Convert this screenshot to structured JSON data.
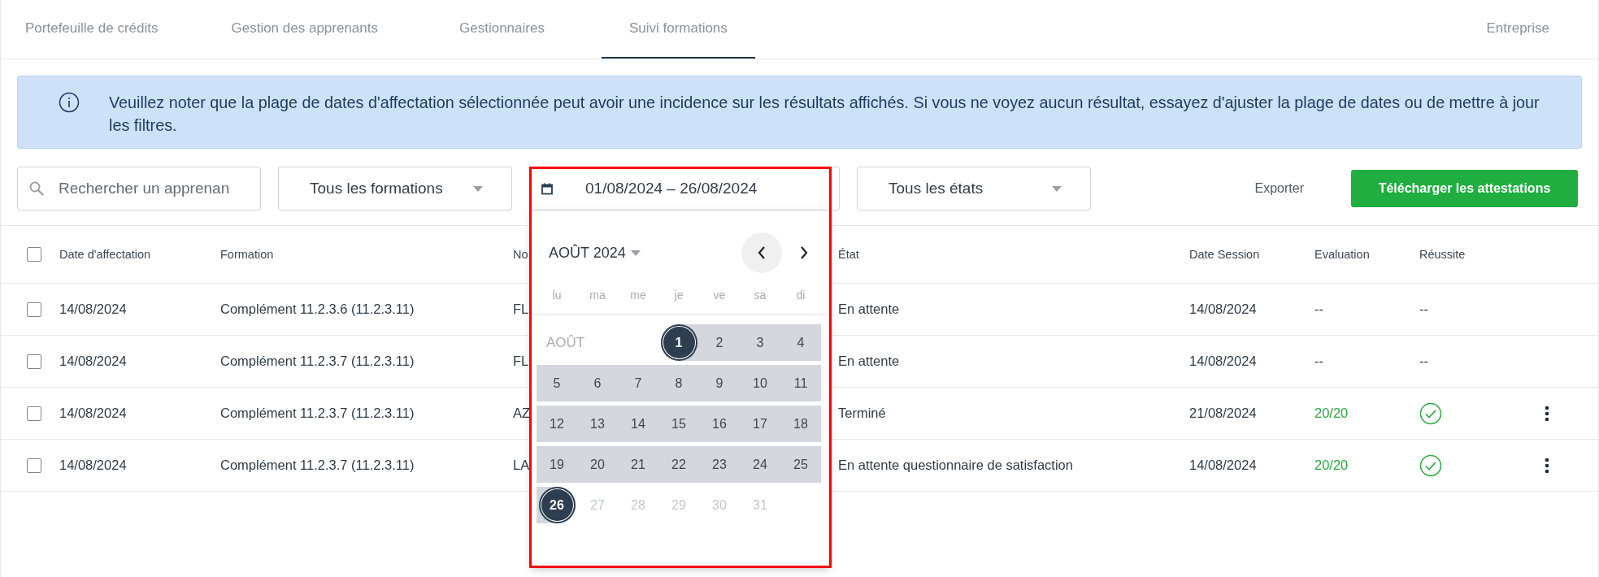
{
  "tabs": [
    {
      "label": "Portefeuille de crédits",
      "selected": false
    },
    {
      "label": "Gestion des apprenants",
      "selected": false
    },
    {
      "label": "Gestionnaires",
      "selected": false
    },
    {
      "label": "Suivi formations",
      "selected": true
    }
  ],
  "company_link": "Entreprise",
  "notice": "Veuillez noter que la plage de dates d'affectation sélectionnée peut avoir une incidence sur les résultats affichés. Si vous ne voyez aucun résultat, essayez d'ajuster la plage de dates ou de mettre à jour les filtres.",
  "search": {
    "placeholder": "Rechercher un apprenan"
  },
  "formation_filter": "Tous les formations",
  "date_filter": {
    "value": "01/08/2024 – 26/08/2024",
    "highlighted": true,
    "open": true
  },
  "state_filter": "Tous les états",
  "export_link": "Exporter",
  "download_button": "Télécharger les attestations",
  "calendar": {
    "title": "AOÛT 2024",
    "month_label": "AOÛT",
    "weekdays": [
      "lu",
      "ma",
      "me",
      "je",
      "ve",
      "sa",
      "di"
    ],
    "weeks": [
      [
        {
          "day": "1",
          "selected": true,
          "in_range": false,
          "disabled": false
        },
        {
          "day": "2",
          "selected": false,
          "in_range": true,
          "disabled": false
        },
        {
          "day": "3",
          "selected": false,
          "in_range": true,
          "disabled": false
        },
        {
          "day": "4",
          "selected": false,
          "in_range": true,
          "disabled": false
        }
      ],
      [
        {
          "day": "5",
          "selected": false,
          "in_range": true,
          "disabled": false
        },
        {
          "day": "6",
          "selected": false,
          "in_range": true,
          "disabled": false
        },
        {
          "day": "7",
          "selected": false,
          "in_range": true,
          "disabled": false
        },
        {
          "day": "8",
          "selected": false,
          "in_range": true,
          "disabled": false
        },
        {
          "day": "9",
          "selected": false,
          "in_range": true,
          "disabled": false
        },
        {
          "day": "10",
          "selected": false,
          "in_range": true,
          "disabled": false
        },
        {
          "day": "11",
          "selected": false,
          "in_range": true,
          "disabled": false
        }
      ],
      [
        {
          "day": "12",
          "selected": false,
          "in_range": true,
          "disabled": false
        },
        {
          "day": "13",
          "selected": false,
          "in_range": true,
          "disabled": false
        },
        {
          "day": "14",
          "selected": false,
          "in_range": true,
          "disabled": false
        },
        {
          "day": "15",
          "selected": false,
          "in_range": true,
          "disabled": false
        },
        {
          "day": "16",
          "selected": false,
          "in_range": true,
          "disabled": false
        },
        {
          "day": "17",
          "selected": false,
          "in_range": true,
          "disabled": false
        },
        {
          "day": "18",
          "selected": false,
          "in_range": true,
          "disabled": false
        }
      ],
      [
        {
          "day": "19",
          "selected": false,
          "in_range": true,
          "disabled": false
        },
        {
          "day": "20",
          "selected": false,
          "in_range": true,
          "disabled": false
        },
        {
          "day": "21",
          "selected": false,
          "in_range": true,
          "disabled": false
        },
        {
          "day": "22",
          "selected": false,
          "in_range": true,
          "disabled": false
        },
        {
          "day": "23",
          "selected": false,
          "in_range": true,
          "disabled": false
        },
        {
          "day": "24",
          "selected": false,
          "in_range": true,
          "disabled": false
        },
        {
          "day": "25",
          "selected": false,
          "in_range": true,
          "disabled": false
        }
      ],
      [
        {
          "day": "26",
          "selected": true,
          "in_range": false,
          "disabled": false
        },
        {
          "day": "27",
          "selected": false,
          "in_range": false,
          "disabled": true
        },
        {
          "day": "28",
          "selected": false,
          "in_range": false,
          "disabled": true
        },
        {
          "day": "29",
          "selected": false,
          "in_range": false,
          "disabled": true
        },
        {
          "day": "30",
          "selected": false,
          "in_range": false,
          "disabled": true
        },
        {
          "day": "31",
          "selected": false,
          "in_range": false,
          "disabled": true
        }
      ]
    ]
  },
  "table": {
    "select_all_checked": false,
    "columns": [
      "Date d'affectation",
      "Formation",
      "No",
      "État",
      "Date Session",
      "Evaluation",
      "Réussite"
    ],
    "rows": [
      {
        "checked": false,
        "date": "14/08/2024",
        "formation": "Complément 11.2.3.6 (11.2.3.11)",
        "name": "FL",
        "state": "En attente",
        "session": "14/08/2024",
        "evaluation": "--",
        "evaluation_passed": false,
        "success": {
          "kind": "text",
          "text": "--"
        },
        "has_menu": false
      },
      {
        "checked": false,
        "date": "14/08/2024",
        "formation": "Complément 11.2.3.7 (11.2.3.11)",
        "name": "FL",
        "state": "En attente",
        "session": "14/08/2024",
        "evaluation": "--",
        "evaluation_passed": false,
        "success": {
          "kind": "text",
          "text": "--"
        },
        "has_menu": false
      },
      {
        "checked": false,
        "date": "14/08/2024",
        "formation": "Complément 11.2.3.7 (11.2.3.11)",
        "name": "AZ",
        "state": "Terminé",
        "session": "21/08/2024",
        "evaluation": "20/20",
        "evaluation_passed": true,
        "success": {
          "kind": "check"
        },
        "has_menu": true
      },
      {
        "checked": false,
        "date": "14/08/2024",
        "formation": "Complément 11.2.3.7 (11.2.3.11)",
        "name": "LA",
        "state": "En attente questionnaire de satisfaction",
        "session": "14/08/2024",
        "evaluation": "20/20",
        "evaluation_passed": true,
        "success": {
          "kind": "check"
        },
        "has_menu": true
      }
    ]
  }
}
